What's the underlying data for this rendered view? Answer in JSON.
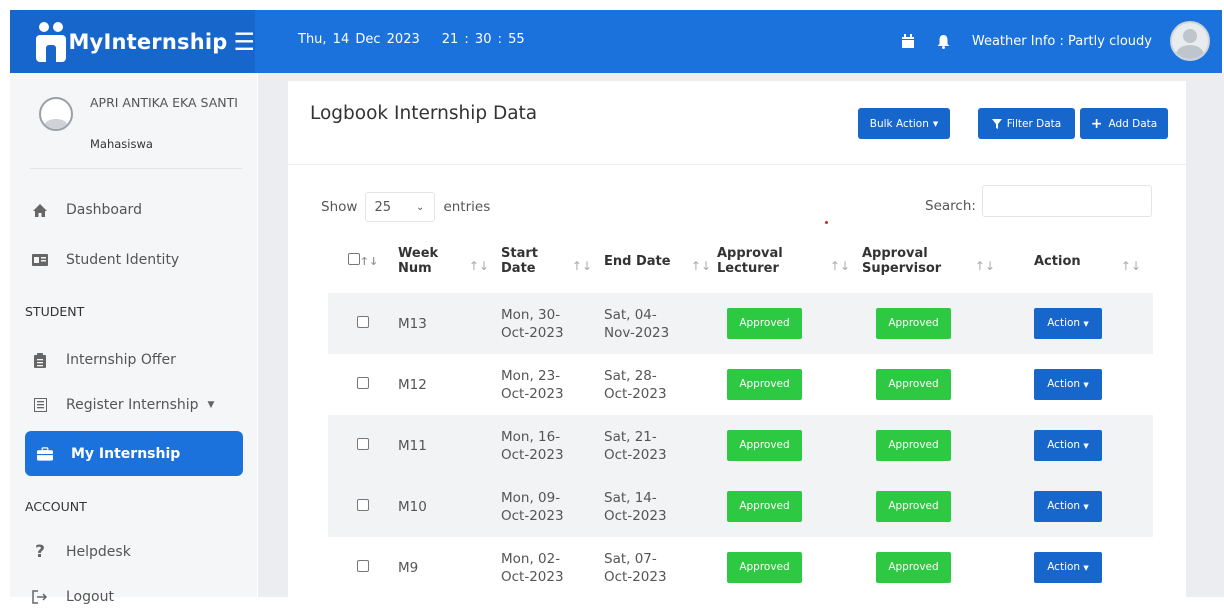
{
  "app": {
    "name": "MyInternship"
  },
  "header": {
    "date": "Thu, 14 Dec 2023",
    "time": "21 : 30 : 55",
    "weather": "Weather Info : Partly cloudy"
  },
  "profile": {
    "name": "APRI ANTIKA EKA SANTI",
    "role": "Mahasiswa"
  },
  "nav": {
    "dashboard": "Dashboard",
    "student_identity": "Student Identity",
    "section_student": "STUDENT",
    "internship_offer": "Internship Offer",
    "register_internship": "Register Internship",
    "my_internship": "My Internship",
    "section_account": "ACCOUNT",
    "helpdesk": "Helpdesk",
    "logout": "Logout"
  },
  "card": {
    "title": "Logbook Internship Data",
    "bulk_action": "Bulk Action",
    "filter_data": "Filter Data",
    "add_data": "Add Data"
  },
  "table_controls": {
    "show": "Show",
    "entries_value": "25",
    "entries": "entries",
    "search": "Search:"
  },
  "table": {
    "headers": {
      "week_a": "Week",
      "week_b": "Num",
      "start_a": "Start",
      "start_b": "Date",
      "end": "End Date",
      "al_a": "Approval",
      "al_b": "Lecturer",
      "as_a": "Approval",
      "as_b": "Supervisor",
      "action": "Action"
    },
    "rows": [
      {
        "week": "M13",
        "start_a": "Mon, 30-",
        "start_b": "Oct-2023",
        "end_a": "Sat, 04-",
        "end_b": "Nov-2023",
        "lecturer": "Approved",
        "supervisor": "Approved",
        "action": "Action"
      },
      {
        "week": "M12",
        "start_a": "Mon, 23-",
        "start_b": "Oct-2023",
        "end_a": "Sat, 28-",
        "end_b": "Oct-2023",
        "lecturer": "Approved",
        "supervisor": "Approved",
        "action": "Action"
      },
      {
        "week": "M11",
        "start_a": "Mon, 16-",
        "start_b": "Oct-2023",
        "end_a": "Sat, 21-",
        "end_b": "Oct-2023",
        "lecturer": "Approved",
        "supervisor": "Approved",
        "action": "Action"
      },
      {
        "week": "M10",
        "start_a": "Mon, 09-",
        "start_b": "Oct-2023",
        "end_a": "Sat, 14-",
        "end_b": "Oct-2023",
        "lecturer": "Approved",
        "supervisor": "Approved",
        "action": "Action"
      },
      {
        "week": "M9",
        "start_a": "Mon, 02-",
        "start_b": "Oct-2023",
        "end_a": "Sat, 07-",
        "end_b": "Oct-2023",
        "lecturer": "Approved",
        "supervisor": "Approved",
        "action": "Action"
      }
    ]
  },
  "colors": {
    "primary": "#1c72dc",
    "approved": "#2ec942"
  }
}
